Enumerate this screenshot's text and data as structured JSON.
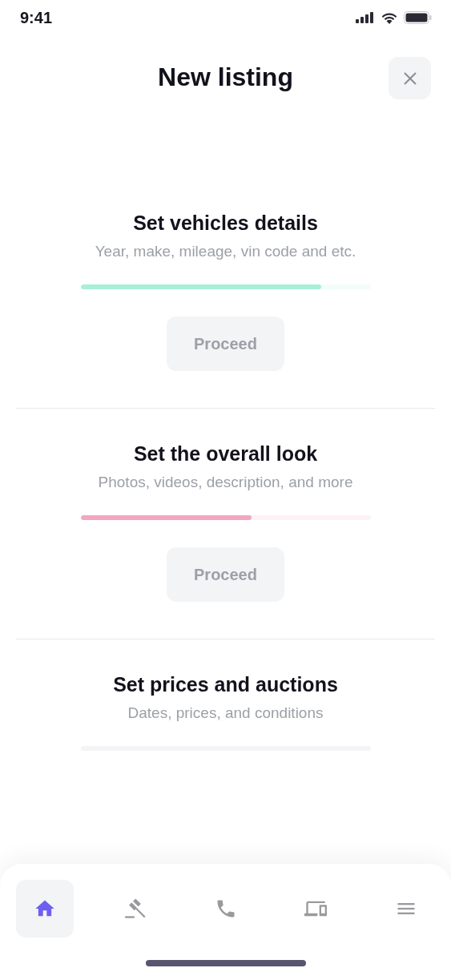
{
  "status_bar": {
    "time": "9:41"
  },
  "header": {
    "title": "New listing"
  },
  "steps": [
    {
      "title": "Set vehicles details",
      "subtitle": "Year, make, mileage, vin code and etc.",
      "level": 0.83,
      "color": "#a8efd9",
      "button": "Proceed"
    },
    {
      "title": "Set the overall look",
      "subtitle": "Photos, videos, description, and more",
      "level": 0.59,
      "color": "#f2a7bf",
      "button": "Proceed"
    },
    {
      "title": "Set prices and auctions",
      "subtitle": "Dates, prices, and conditions",
      "color": "#f3f4f6"
    }
  ],
  "tab_bar": [
    {
      "kind": "home",
      "selected": true
    },
    {
      "kind": "gavel",
      "selected": false
    },
    {
      "kind": "phone",
      "selected": false
    },
    {
      "kind": "devices",
      "selected": false
    },
    {
      "kind": "menu",
      "selected": false
    }
  ]
}
